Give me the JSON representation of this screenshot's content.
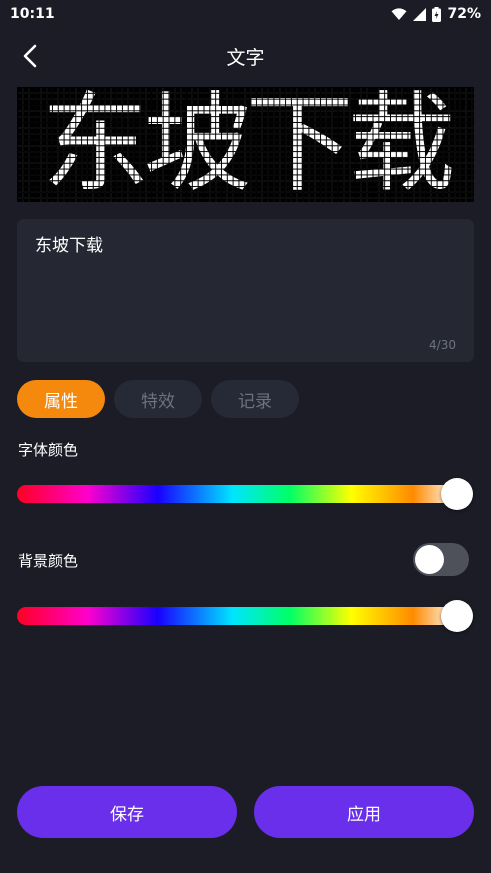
{
  "status": {
    "time": "10:11",
    "battery": "72%"
  },
  "header": {
    "title": "文字"
  },
  "preview": {
    "text": "东坡下载"
  },
  "input": {
    "value": "东坡下载",
    "count": "4/30"
  },
  "tabs": [
    {
      "label": "属性",
      "active": true
    },
    {
      "label": "特效",
      "active": false
    },
    {
      "label": "记录",
      "active": false
    }
  ],
  "font_color": {
    "label": "字体颜色",
    "value": 1.0
  },
  "background_color": {
    "label": "背景颜色",
    "enabled": false,
    "value": 1.0
  },
  "actions": {
    "save": "保存",
    "apply": "应用"
  },
  "colors": {
    "accent": "#f5890d",
    "primary_button": "#6a2fea",
    "background": "#1b1c26"
  }
}
